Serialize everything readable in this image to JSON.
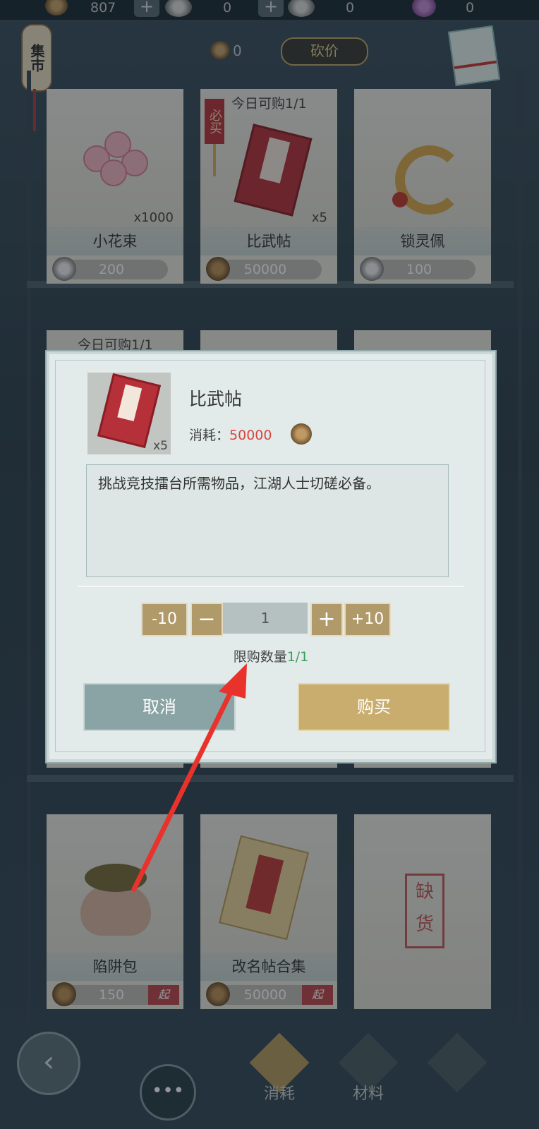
{
  "topbar": {
    "coins": "807",
    "silver": "0",
    "shells": "0",
    "flowers": "0"
  },
  "side_tab": {
    "label": "集市"
  },
  "haggle": {
    "coin_count": "0",
    "button_label": "砍价"
  },
  "shop_items": [
    {
      "name": "小花束",
      "price": "200",
      "qty": "x1000",
      "currency": "silver"
    },
    {
      "name": "比武帖",
      "price": "50000",
      "qty": "x5",
      "currency": "coin",
      "daily_limit": "今日可购1/1",
      "must_buy": "必买"
    },
    {
      "name": "锁灵佩",
      "price": "100",
      "qty": "",
      "currency": "silver"
    },
    {
      "name": "陷阱包",
      "price": "150",
      "qty": "",
      "currency": "coin",
      "start_tag": "起"
    },
    {
      "name": "改名帖合集",
      "price": "50000",
      "qty": "",
      "currency": "coin",
      "start_tag": "起"
    },
    {
      "name": "",
      "price": "",
      "qty": "",
      "soldout": "缺货"
    }
  ],
  "second_row_tag": "今日可购1/1",
  "modal": {
    "item_name": "比武帖",
    "item_qty": "x5",
    "cost_label": "消耗：",
    "cost_value": "50000",
    "description": "挑战竞技擂台所需物品，江湖人士切磋必备。",
    "minus10": "-10",
    "minus": "−",
    "quantity": "1",
    "plus": "+",
    "plus10": "+10",
    "limit_label": "限购数量",
    "limit_value": "1/1",
    "cancel": "取消",
    "buy": "购买"
  },
  "bottom_nav": {
    "tabs": [
      "消耗",
      "材料"
    ]
  },
  "colors": {
    "accent_gold": "#c8ad6f",
    "cancel_gray": "#8aa3a5",
    "cost_red": "#d9443f",
    "limit_green": "#3a9d5d",
    "annotation_arrow": "#e8322b"
  }
}
